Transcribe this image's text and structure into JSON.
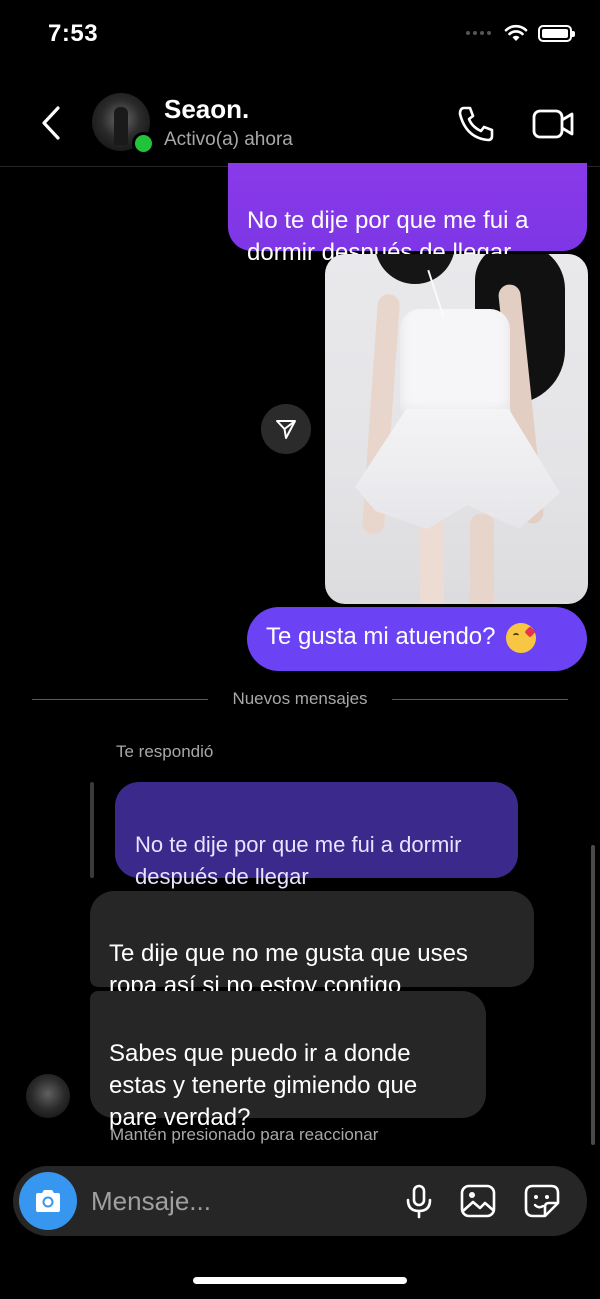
{
  "status_bar": {
    "time": "7:53"
  },
  "header": {
    "contact_name": "Seaon.",
    "contact_status": "Activo(a) ahora"
  },
  "messages": {
    "sent_1": "No te dije por que me fui a\ndormir después de llegar",
    "sent_2": "Te gusta mi atuendo?",
    "divider": "Nuevos mensajes",
    "reply_label": "Te respondió",
    "quoted": "No te dije por que me fui a dormir\ndespués de llegar",
    "received_1": "Te dije que no me gusta que uses\nropa así si no estoy contigo",
    "received_2": "Sabes que puedo ir a donde\nestas y tenerte gimiendo que\npare verdad?",
    "hint": "Mantén presionado para reaccionar"
  },
  "composer": {
    "placeholder": "Mensaje..."
  },
  "colors": {
    "sent_bubble": "#7d36e6",
    "sent_bubble_2": "#6b43f5",
    "quoted_bubble": "#3b2a8c",
    "received_bubble": "#262626",
    "camera_button": "#3797f0",
    "online": "#22c33a"
  },
  "icons": [
    "chevron-left-icon",
    "phone-icon",
    "video-icon",
    "share-icon",
    "camera-icon",
    "mic-icon",
    "gallery-icon",
    "sticker-icon",
    "wifi-icon",
    "battery-icon",
    "kiss-emoji"
  ]
}
